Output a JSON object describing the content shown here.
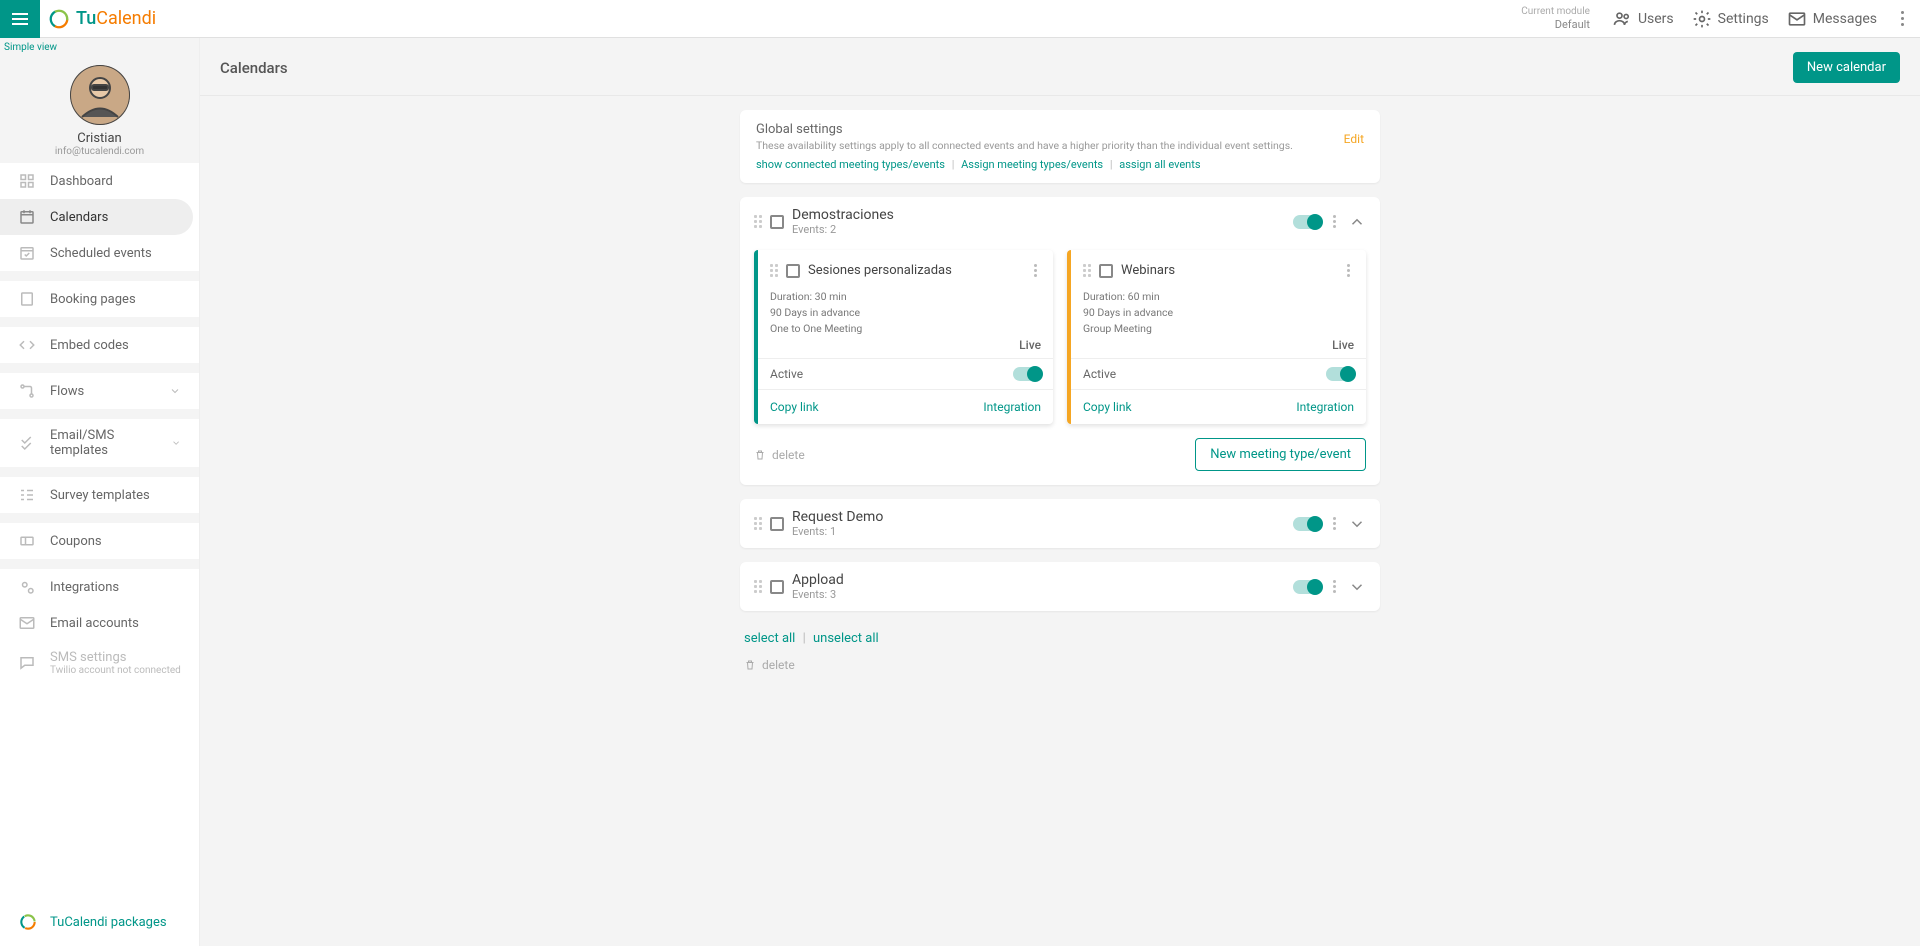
{
  "header": {
    "logo_tu": "Tu",
    "logo_cal": "Calendi",
    "module_label": "Current module",
    "module_value": "Default",
    "users": "Users",
    "settings": "Settings",
    "messages": "Messages"
  },
  "sidebar": {
    "simple_view": "Simple view",
    "profile_name": "Cristian",
    "profile_email": "info@tucalendi.com",
    "items": {
      "dashboard": "Dashboard",
      "calendars": "Calendars",
      "scheduled": "Scheduled events",
      "booking": "Booking pages",
      "embed": "Embed codes",
      "flows": "Flows",
      "email_sms": "Email/SMS templates",
      "survey": "Survey templates",
      "coupons": "Coupons",
      "integrations": "Integrations",
      "email_accounts": "Email accounts",
      "sms_settings": "SMS settings",
      "sms_sub": "Twilio account not connected"
    },
    "footer": "TuCalendi packages"
  },
  "page": {
    "title": "Calendars",
    "new_btn": "New calendar"
  },
  "global": {
    "title": "Global settings",
    "desc": "These availability settings apply to all connected events and have a higher priority than the individual event settings.",
    "link1": "show connected meeting types/events",
    "link2": "Assign meeting types/events",
    "link3": "assign all events",
    "edit": "Edit"
  },
  "calendars": [
    {
      "title": "Demostraciones",
      "sub": "Events: 2",
      "expanded": true,
      "events": [
        {
          "title": "Sesiones personalizadas",
          "duration": "Duration: 30 min",
          "advance": "90 Days in advance",
          "meeting": "One to One Meeting",
          "live": "Live",
          "active": "Active",
          "copy": "Copy link",
          "integration": "Integration",
          "variant": "teal"
        },
        {
          "title": "Webinars",
          "duration": "Duration: 60 min",
          "advance": "90 Days in advance",
          "meeting": "Group Meeting",
          "live": "Live",
          "active": "Active",
          "copy": "Copy link",
          "integration": "Integration",
          "variant": "orange"
        }
      ],
      "delete": "delete",
      "new_event": "New meeting type/event"
    },
    {
      "title": "Request Demo",
      "sub": "Events: 1",
      "expanded": false
    },
    {
      "title": "Appload",
      "sub": "Events: 3",
      "expanded": false
    }
  ],
  "footer": {
    "select_all": "select all",
    "unselect_all": "unselect all",
    "delete": "delete"
  }
}
